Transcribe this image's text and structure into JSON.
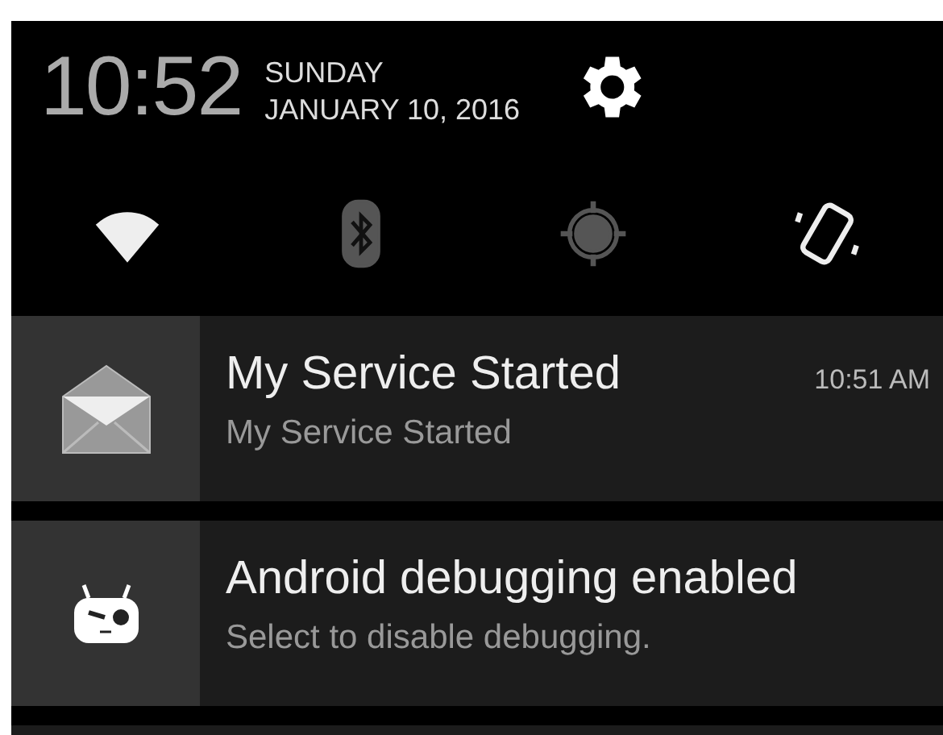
{
  "header": {
    "time": "10:52",
    "day": "SUNDAY",
    "date": "JANUARY 10, 2016"
  },
  "toggles": [
    {
      "kind": "wifi",
      "on": true
    },
    {
      "kind": "bluetooth",
      "on": false
    },
    {
      "kind": "location",
      "on": false
    },
    {
      "kind": "rotation",
      "on": true
    }
  ],
  "notifications": [
    {
      "kind": "mail",
      "title": "My Service Started",
      "text": "My Service Started",
      "time": "10:51 AM"
    },
    {
      "kind": "debug",
      "title": "Android debugging enabled",
      "text": "Select to disable debugging."
    }
  ]
}
